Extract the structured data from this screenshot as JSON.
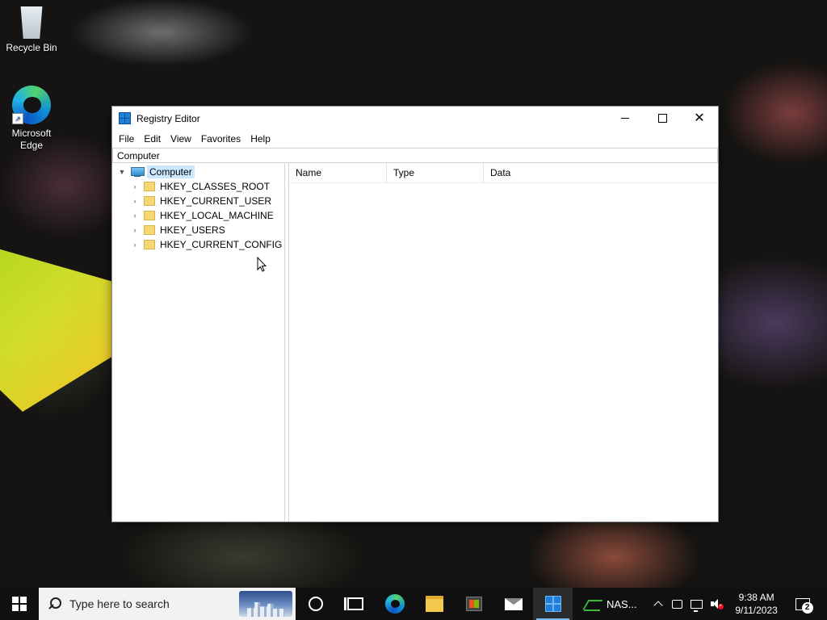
{
  "desktop": {
    "icons": [
      {
        "label": "Recycle Bin",
        "icon": "recycle-bin-icon"
      },
      {
        "label": "Microsoft\nEdge",
        "icon": "edge-icon"
      }
    ]
  },
  "window": {
    "title": "Registry Editor",
    "menu": [
      "File",
      "Edit",
      "View",
      "Favorites",
      "Help"
    ],
    "address": "Computer",
    "tree": {
      "root": "Computer",
      "children": [
        "HKEY_CLASSES_ROOT",
        "HKEY_CURRENT_USER",
        "HKEY_LOCAL_MACHINE",
        "HKEY_USERS",
        "HKEY_CURRENT_CONFIG"
      ]
    },
    "columns": {
      "name": "Name",
      "type": "Type",
      "data": "Data"
    }
  },
  "taskbar": {
    "search_placeholder": "Type here to search",
    "running_app_label": "NAS...",
    "clock_time": "9:38 AM",
    "clock_date": "9/11/2023",
    "notification_count": "2",
    "accent_color": "#76b9ed"
  }
}
